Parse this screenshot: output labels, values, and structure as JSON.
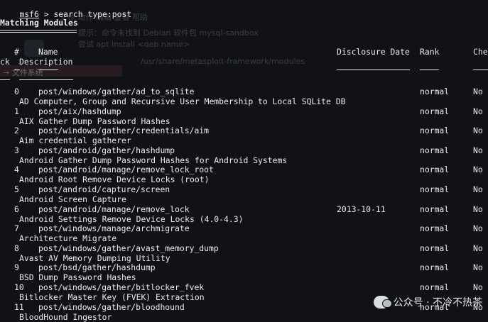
{
  "terminal": {
    "prompt": "msf6",
    "prompt_sep": " > ",
    "command": "search type:post",
    "section_title": "Matching Modules",
    "headers": {
      "num": "#",
      "name": "Name",
      "disclosure": "Disclosure Date",
      "rank": "Rank",
      "check": "Che",
      "check_wrap": "ck",
      "description": "Description"
    },
    "modules": [
      {
        "num": "0",
        "name": "post/windows/gather/ad_to_sqlite",
        "date": "",
        "rank": "normal",
        "check": "No",
        "description": "AD Computer, Group and Recursive User Membership to Local SQLite DB"
      },
      {
        "num": "1",
        "name": "post/aix/hashdump",
        "date": "",
        "rank": "normal",
        "check": "No",
        "description": "AIX Gather Dump Password Hashes"
      },
      {
        "num": "2",
        "name": "post/windows/gather/credentials/aim",
        "date": "",
        "rank": "normal",
        "check": "No",
        "description": "Aim credential gatherer"
      },
      {
        "num": "3",
        "name": "post/android/gather/hashdump",
        "date": "",
        "rank": "normal",
        "check": "No",
        "description": "Android Gather Dump Password Hashes for Android Systems"
      },
      {
        "num": "4",
        "name": "post/android/manage/remove_lock_root",
        "date": "",
        "rank": "normal",
        "check": "No",
        "description": "Android Root Remove Device Locks (root)"
      },
      {
        "num": "5",
        "name": "post/android/capture/screen",
        "date": "",
        "rank": "normal",
        "check": "No",
        "description": "Android Screen Capture"
      },
      {
        "num": "6",
        "name": "post/android/manage/remove_lock",
        "date": "2013-10-11",
        "rank": "normal",
        "check": "No",
        "description": "Android Settings Remove Device Locks (4.0-4.3)"
      },
      {
        "num": "7",
        "name": "post/windows/manage/archmigrate",
        "date": "",
        "rank": "normal",
        "check": "No",
        "description": "Architecture Migrate"
      },
      {
        "num": "8",
        "name": "post/windows/gather/avast_memory_dump",
        "date": "",
        "rank": "normal",
        "check": "No",
        "description": "Avast AV Memory Dumping Utility"
      },
      {
        "num": "9",
        "name": "post/bsd/gather/hashdump",
        "date": "",
        "rank": "normal",
        "check": "No",
        "description": "BSD Dump Password Hashes"
      },
      {
        "num": "10",
        "name": "post/windows/gather/bitlocker_fvek",
        "date": "",
        "rank": "normal",
        "check": "No",
        "description": "Bitlocker Master Key (FVEK) Extraction"
      },
      {
        "num": "11",
        "name": "post/windows/gather/bloodhound",
        "date": "",
        "rank": "normal",
        "check": "No",
        "description": "BloodHound Ingestor"
      }
    ]
  },
  "background_ghost": {
    "menu": "文件   动作   编辑   查看   帮助",
    "line1": "提示：命令未找到 Debian 软件包 mysql-sandbox",
    "line2": "尝试 apt install <deb name>",
    "path": "/usr/share/metasploit-framework/modules",
    "line3": "→ 文件系统"
  },
  "watermark": {
    "icon": "wechat-icon",
    "text": "公众号 · 不冷不热茶"
  }
}
